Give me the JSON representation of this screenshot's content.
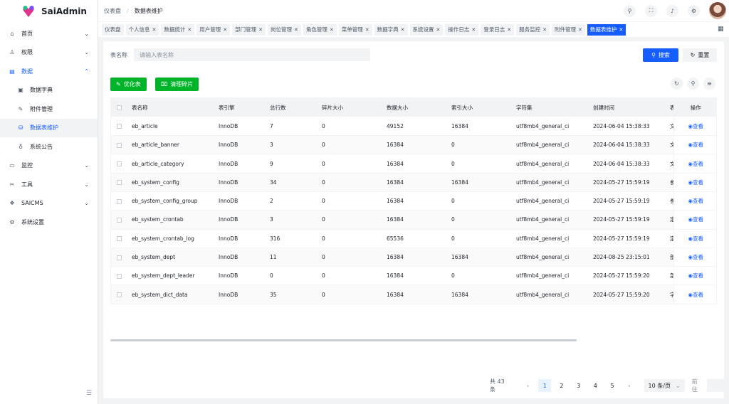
{
  "app": {
    "name": "SaiAdmin"
  },
  "sidebar": {
    "items": [
      {
        "label": "首页",
        "icon": "home-icon",
        "chevron": "⌄"
      },
      {
        "label": "权限",
        "icon": "user-icon",
        "chevron": "⌄"
      },
      {
        "label": "数据",
        "icon": "database-icon",
        "chevron": "⌃"
      },
      {
        "label": "数据字典",
        "icon": "book-icon"
      },
      {
        "label": "附件管理",
        "icon": "pin-icon"
      },
      {
        "label": "数据表维护",
        "icon": "storage-icon"
      },
      {
        "label": "系统公告",
        "icon": "bulb-icon"
      },
      {
        "label": "监控",
        "icon": "monitor-icon",
        "chevron": "⌄"
      },
      {
        "label": "工具",
        "icon": "tool-icon",
        "chevron": "⌄"
      },
      {
        "label": "SAICMS",
        "icon": "cms-icon",
        "chevron": "⌄"
      },
      {
        "label": "系统设置",
        "icon": "settings-icon"
      }
    ]
  },
  "header": {
    "breadcrumb": [
      "仪表盘",
      "数据表维护"
    ]
  },
  "tabs": [
    {
      "label": "仪表盘",
      "closable": false
    },
    {
      "label": "个人信息",
      "closable": true
    },
    {
      "label": "数据统计",
      "closable": true
    },
    {
      "label": "用户管理",
      "closable": true
    },
    {
      "label": "部门管理",
      "closable": true
    },
    {
      "label": "岗位管理",
      "closable": true
    },
    {
      "label": "角色管理",
      "closable": true
    },
    {
      "label": "菜单管理",
      "closable": true
    },
    {
      "label": "数据字典",
      "closable": true
    },
    {
      "label": "系统设置",
      "closable": true
    },
    {
      "label": "操作日志",
      "closable": true
    },
    {
      "label": "登录日志",
      "closable": true
    },
    {
      "label": "服务监控",
      "closable": true
    },
    {
      "label": "附件管理",
      "closable": true
    },
    {
      "label": "数据表维护",
      "closable": true,
      "active": true
    }
  ],
  "filter": {
    "label": "表名称",
    "placeholder": "请输入表名称",
    "search": "搜索",
    "reset": "重置"
  },
  "toolbar": {
    "optimize": "优化表",
    "clean": "清理碎片"
  },
  "table": {
    "columns": [
      "表名称",
      "表引擎",
      "总行数",
      "碎片大小",
      "数据大小",
      "索引大小",
      "字符集",
      "创建时间",
      "表注释",
      "操作"
    ],
    "view_label": "查看",
    "rows": [
      [
        "eb_article",
        "InnoDB",
        "7",
        "0",
        "49152",
        "16384",
        "utf8mb4_general_ci",
        "2024-06-04 15:38:33",
        "文章表"
      ],
      [
        "eb_article_banner",
        "InnoDB",
        "3",
        "0",
        "16384",
        "0",
        "utf8mb4_general_ci",
        "2024-06-04 15:38:33",
        "文章轮播图"
      ],
      [
        "eb_article_category",
        "InnoDB",
        "9",
        "0",
        "16384",
        "0",
        "utf8mb4_general_ci",
        "2024-06-04 15:38:33",
        "文章分类表"
      ],
      [
        "eb_system_config",
        "InnoDB",
        "34",
        "0",
        "16384",
        "16384",
        "utf8mb4_general_ci",
        "2024-05-27 15:59:19",
        "参数配置"
      ],
      [
        "eb_system_config_group",
        "InnoDB",
        "2",
        "0",
        "16384",
        "0",
        "utf8mb4_general_ci",
        "2024-05-27 15:59:19",
        "参数配置分组"
      ],
      [
        "eb_system_crontab",
        "InnoDB",
        "3",
        "0",
        "16384",
        "0",
        "utf8mb4_general_ci",
        "2024-05-27 15:59:19",
        "定时任务"
      ],
      [
        "eb_system_crontab_log",
        "InnoDB",
        "316",
        "0",
        "65536",
        "0",
        "utf8mb4_general_ci",
        "2024-05-27 15:59:19",
        "定时任务日志"
      ],
      [
        "eb_system_dept",
        "InnoDB",
        "11",
        "0",
        "16384",
        "16384",
        "utf8mb4_general_ci",
        "2024-08-25 23:15:01",
        "部门信息"
      ],
      [
        "eb_system_dept_leader",
        "InnoDB",
        "0",
        "0",
        "16384",
        "0",
        "utf8mb4_general_ci",
        "2024-05-27 15:59:20",
        "部门领导"
      ],
      [
        "eb_system_dict_data",
        "InnoDB",
        "35",
        "0",
        "16384",
        "16384",
        "utf8mb4_general_ci",
        "2024-05-27 15:59:20",
        "字典数据"
      ]
    ]
  },
  "pagination": {
    "total": "共 43 条",
    "pages": [
      "1",
      "2",
      "3",
      "4",
      "5"
    ],
    "current": "1",
    "page_size": "10 条/页",
    "goto": "前往"
  },
  "colors": {
    "primary": "#165dff",
    "success": "#00b42a"
  }
}
